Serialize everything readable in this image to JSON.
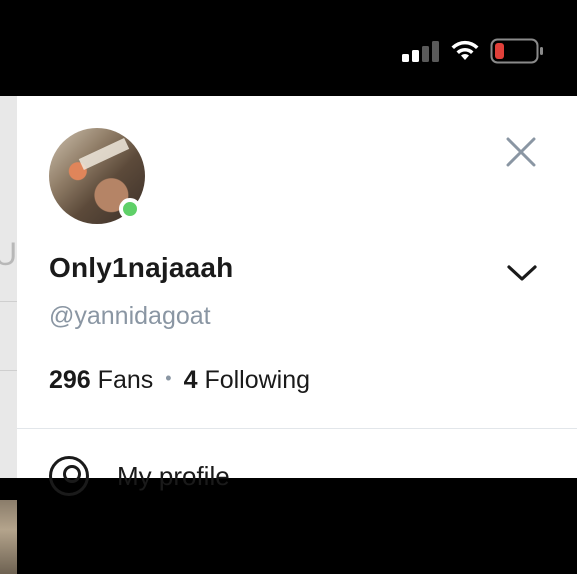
{
  "status_bar": {
    "signal_icon": "cellular-signal-icon",
    "wifi_icon": "wifi-icon",
    "battery_icon": "battery-low-icon",
    "battery_color": "#e0403a"
  },
  "profile": {
    "display_name": "Only1najaaah",
    "username": "@yannidagoat",
    "online": true,
    "online_color": "#5fd068",
    "fans_count": "296",
    "fans_label": "Fans",
    "separator": "•",
    "following_count": "4",
    "following_label": "Following"
  },
  "menu": {
    "items": [
      {
        "label": "My profile",
        "icon": "user-circle-icon"
      }
    ]
  }
}
